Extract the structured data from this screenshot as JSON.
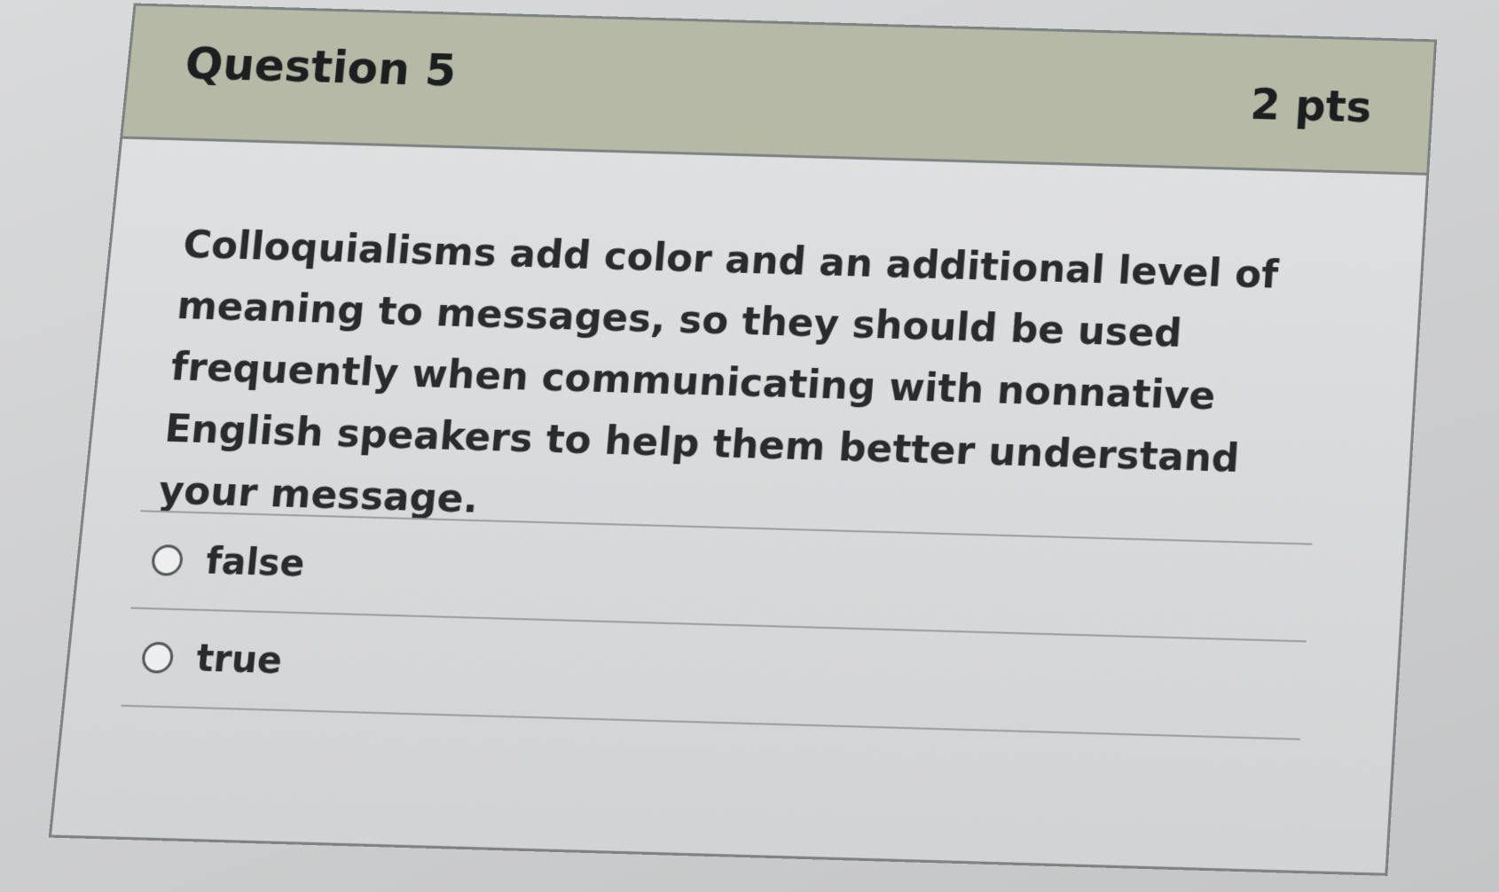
{
  "question": {
    "title": "Question 5",
    "points": "2 pts",
    "text": "Colloquialisms add color and an additional level of meaning to messages, so they should be used frequently when communicating with nonnative English speakers to help them better understand your message."
  },
  "answers": [
    {
      "label": "false",
      "selected": false
    },
    {
      "label": "true",
      "selected": false
    }
  ],
  "colors": {
    "header_background": "#b6b9a6",
    "card_border": "#7f8283",
    "text": "#2a2b2c"
  }
}
